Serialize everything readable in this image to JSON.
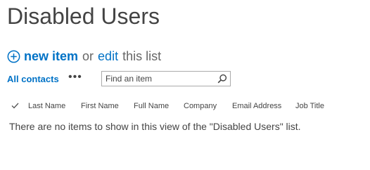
{
  "page": {
    "title": "Disabled Users"
  },
  "actions": {
    "new_item_label": "new item",
    "or_text": "or",
    "edit_label": "edit",
    "edit_suffix": "this list"
  },
  "view": {
    "current_view": "All contacts",
    "more_label": "•••"
  },
  "search": {
    "placeholder": "Find an item"
  },
  "table": {
    "columns": [
      "Last Name",
      "First Name",
      "Full Name",
      "Company",
      "Email Address",
      "Job Title"
    ],
    "empty_message": "There are no items to show in this view of the \"Disabled Users\" list."
  },
  "colors": {
    "accent": "#0072c6",
    "text": "#444444"
  }
}
